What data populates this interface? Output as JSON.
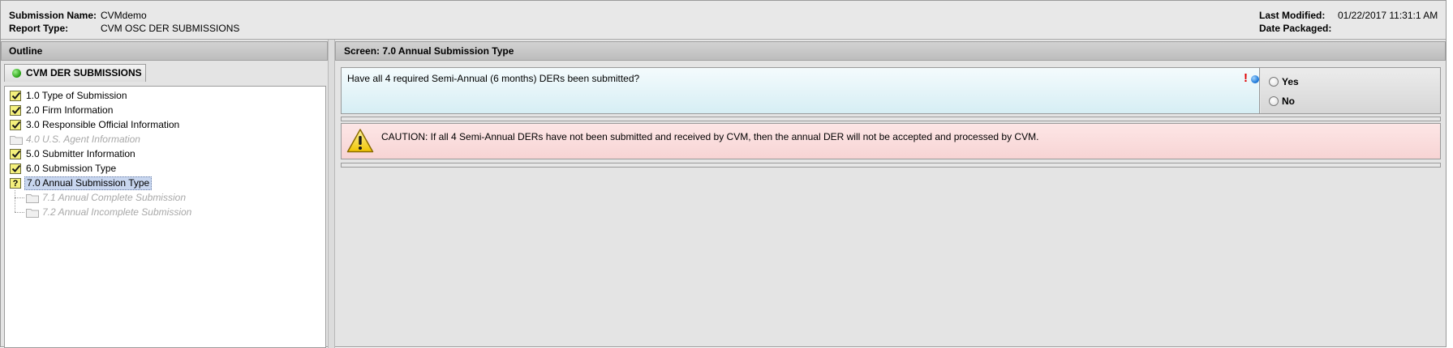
{
  "header": {
    "submission_name_label": "Submission Name:",
    "submission_name_value": "CVMdemo",
    "report_type_label": "Report Type:",
    "report_type_value": "CVM OSC DER SUBMISSIONS",
    "last_modified_label": "Last Modified:",
    "last_modified_value": "01/22/2017 11:31:1 AM",
    "date_packaged_label": "Date Packaged:",
    "date_packaged_value": ""
  },
  "outline": {
    "title": "Outline",
    "tab_label": "CVM DER SUBMISSIONS",
    "status_color": "#2ea51a",
    "items": [
      {
        "label": "1.0 Type of Submission",
        "status": "complete",
        "icon": "check-icon"
      },
      {
        "label": "2.0 Firm Information",
        "status": "complete",
        "icon": "check-icon"
      },
      {
        "label": "3.0 Responsible Official Information",
        "status": "complete",
        "icon": "check-icon"
      },
      {
        "label": "4.0 U.S. Agent Information",
        "status": "disabled",
        "icon": "folder-icon"
      },
      {
        "label": "5.0 Submitter Information",
        "status": "complete",
        "icon": "check-icon"
      },
      {
        "label": "6.0 Submission Type",
        "status": "complete",
        "icon": "check-icon"
      },
      {
        "label": "7.0 Annual Submission Type",
        "status": "incomplete-selected",
        "icon": "question-icon"
      },
      {
        "label": "7.1 Annual Complete Submission",
        "status": "disabled",
        "icon": "folder-icon"
      },
      {
        "label": "7.2 Annual Incomplete Submission",
        "status": "disabled",
        "icon": "folder-icon"
      }
    ]
  },
  "screen": {
    "title": "Screen: 7.0 Annual Submission Type",
    "question": {
      "text": "Have all 4 required Semi-Annual (6 months) DERs been submitted?",
      "required_mark": "!",
      "options": [
        "Yes",
        "No"
      ],
      "selected": null
    },
    "caution": {
      "text": "CAUTION: If all 4 Semi-Annual DERs have not been submitted and received by CVM, then the annual DER will not be accepted and processed by CVM.",
      "background_color": "#fde6e6"
    }
  }
}
